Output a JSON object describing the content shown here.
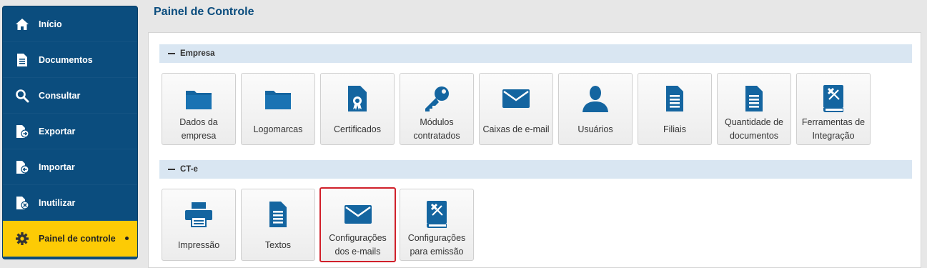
{
  "sidebar": {
    "items": [
      {
        "label": "Início",
        "icon": "home-icon"
      },
      {
        "label": "Documentos",
        "icon": "document-icon"
      },
      {
        "label": "Consultar",
        "icon": "search-icon"
      },
      {
        "label": "Exportar",
        "icon": "export-icon"
      },
      {
        "label": "Importar",
        "icon": "import-icon"
      },
      {
        "label": "Inutilizar",
        "icon": "void-document-icon"
      },
      {
        "label": "Painel de controle",
        "icon": "gear-icon",
        "active": true
      }
    ]
  },
  "header": {
    "title": "Painel de Controle"
  },
  "sections": [
    {
      "title": "Empresa",
      "tiles": [
        {
          "label": "Dados da empresa",
          "icon": "folder-icon"
        },
        {
          "label": "Logomarcas",
          "icon": "folder-icon"
        },
        {
          "label": "Certificados",
          "icon": "certificate-icon"
        },
        {
          "label": "Módulos contratados",
          "icon": "key-icon"
        },
        {
          "label": "Caixas de e-mail",
          "icon": "envelope-icon"
        },
        {
          "label": "Usuários",
          "icon": "user-icon"
        },
        {
          "label": "Filiais",
          "icon": "document-icon"
        },
        {
          "label": "Quantidade de documentos",
          "icon": "document-icon"
        },
        {
          "label": "Ferramentas de Integração",
          "icon": "tools-book-icon"
        }
      ]
    },
    {
      "title": "CT-e",
      "tiles": [
        {
          "label": "Impressão",
          "icon": "printer-icon"
        },
        {
          "label": "Textos",
          "icon": "document-icon"
        },
        {
          "label": "Configurações dos e-mails",
          "icon": "envelope-icon",
          "highlighted": true
        },
        {
          "label": "Configurações para emissão",
          "icon": "tools-book-icon"
        }
      ]
    }
  ],
  "colors": {
    "brand": "#0b4d7e",
    "active": "#fdcb05",
    "highlight": "#d0202a",
    "section_bg": "#d9e6f2",
    "icon": "#1465a0"
  }
}
